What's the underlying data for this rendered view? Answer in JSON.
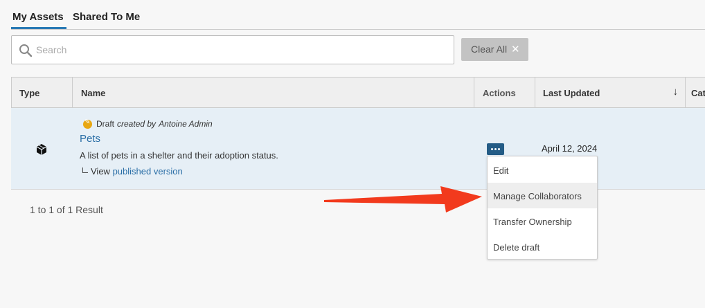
{
  "tabs": [
    {
      "label": "My Assets",
      "active": true
    },
    {
      "label": "Shared To Me",
      "active": false
    }
  ],
  "search": {
    "placeholder": "Search",
    "value": ""
  },
  "clear_all": {
    "label": "Clear All",
    "icon": "close-icon"
  },
  "table": {
    "headers": {
      "type": "Type",
      "name": "Name",
      "actions": "Actions",
      "last_updated": "Last Updated",
      "category": "Cate"
    },
    "sort": {
      "column": "Last Updated",
      "direction": "descending",
      "icon": "arrow-down-icon"
    },
    "rows": [
      {
        "type_icon": "cube-icon",
        "status": "Draft",
        "created_by_prefix": "created by",
        "created_by_name": "Antoine Admin",
        "title": "Pets",
        "description": "A list of pets in a shelter and their adoption status.",
        "view_prefix": "View",
        "view_link": "published version",
        "last_updated": "April 12, 2024"
      }
    ]
  },
  "result_count": "1 to 1 of 1 Result",
  "actions_menu": {
    "items": [
      "Edit",
      "Manage Collaborators",
      "Transfer Ownership",
      "Delete draft"
    ],
    "highlighted": "Manage Collaborators"
  },
  "colors": {
    "accent": "#2a7ab5",
    "link": "#2a6ea6",
    "row_selected": "#e6eff6",
    "actions_button": "#245c86",
    "draft_badge": "#e8a712",
    "annotation_arrow": "#f23a1d"
  }
}
